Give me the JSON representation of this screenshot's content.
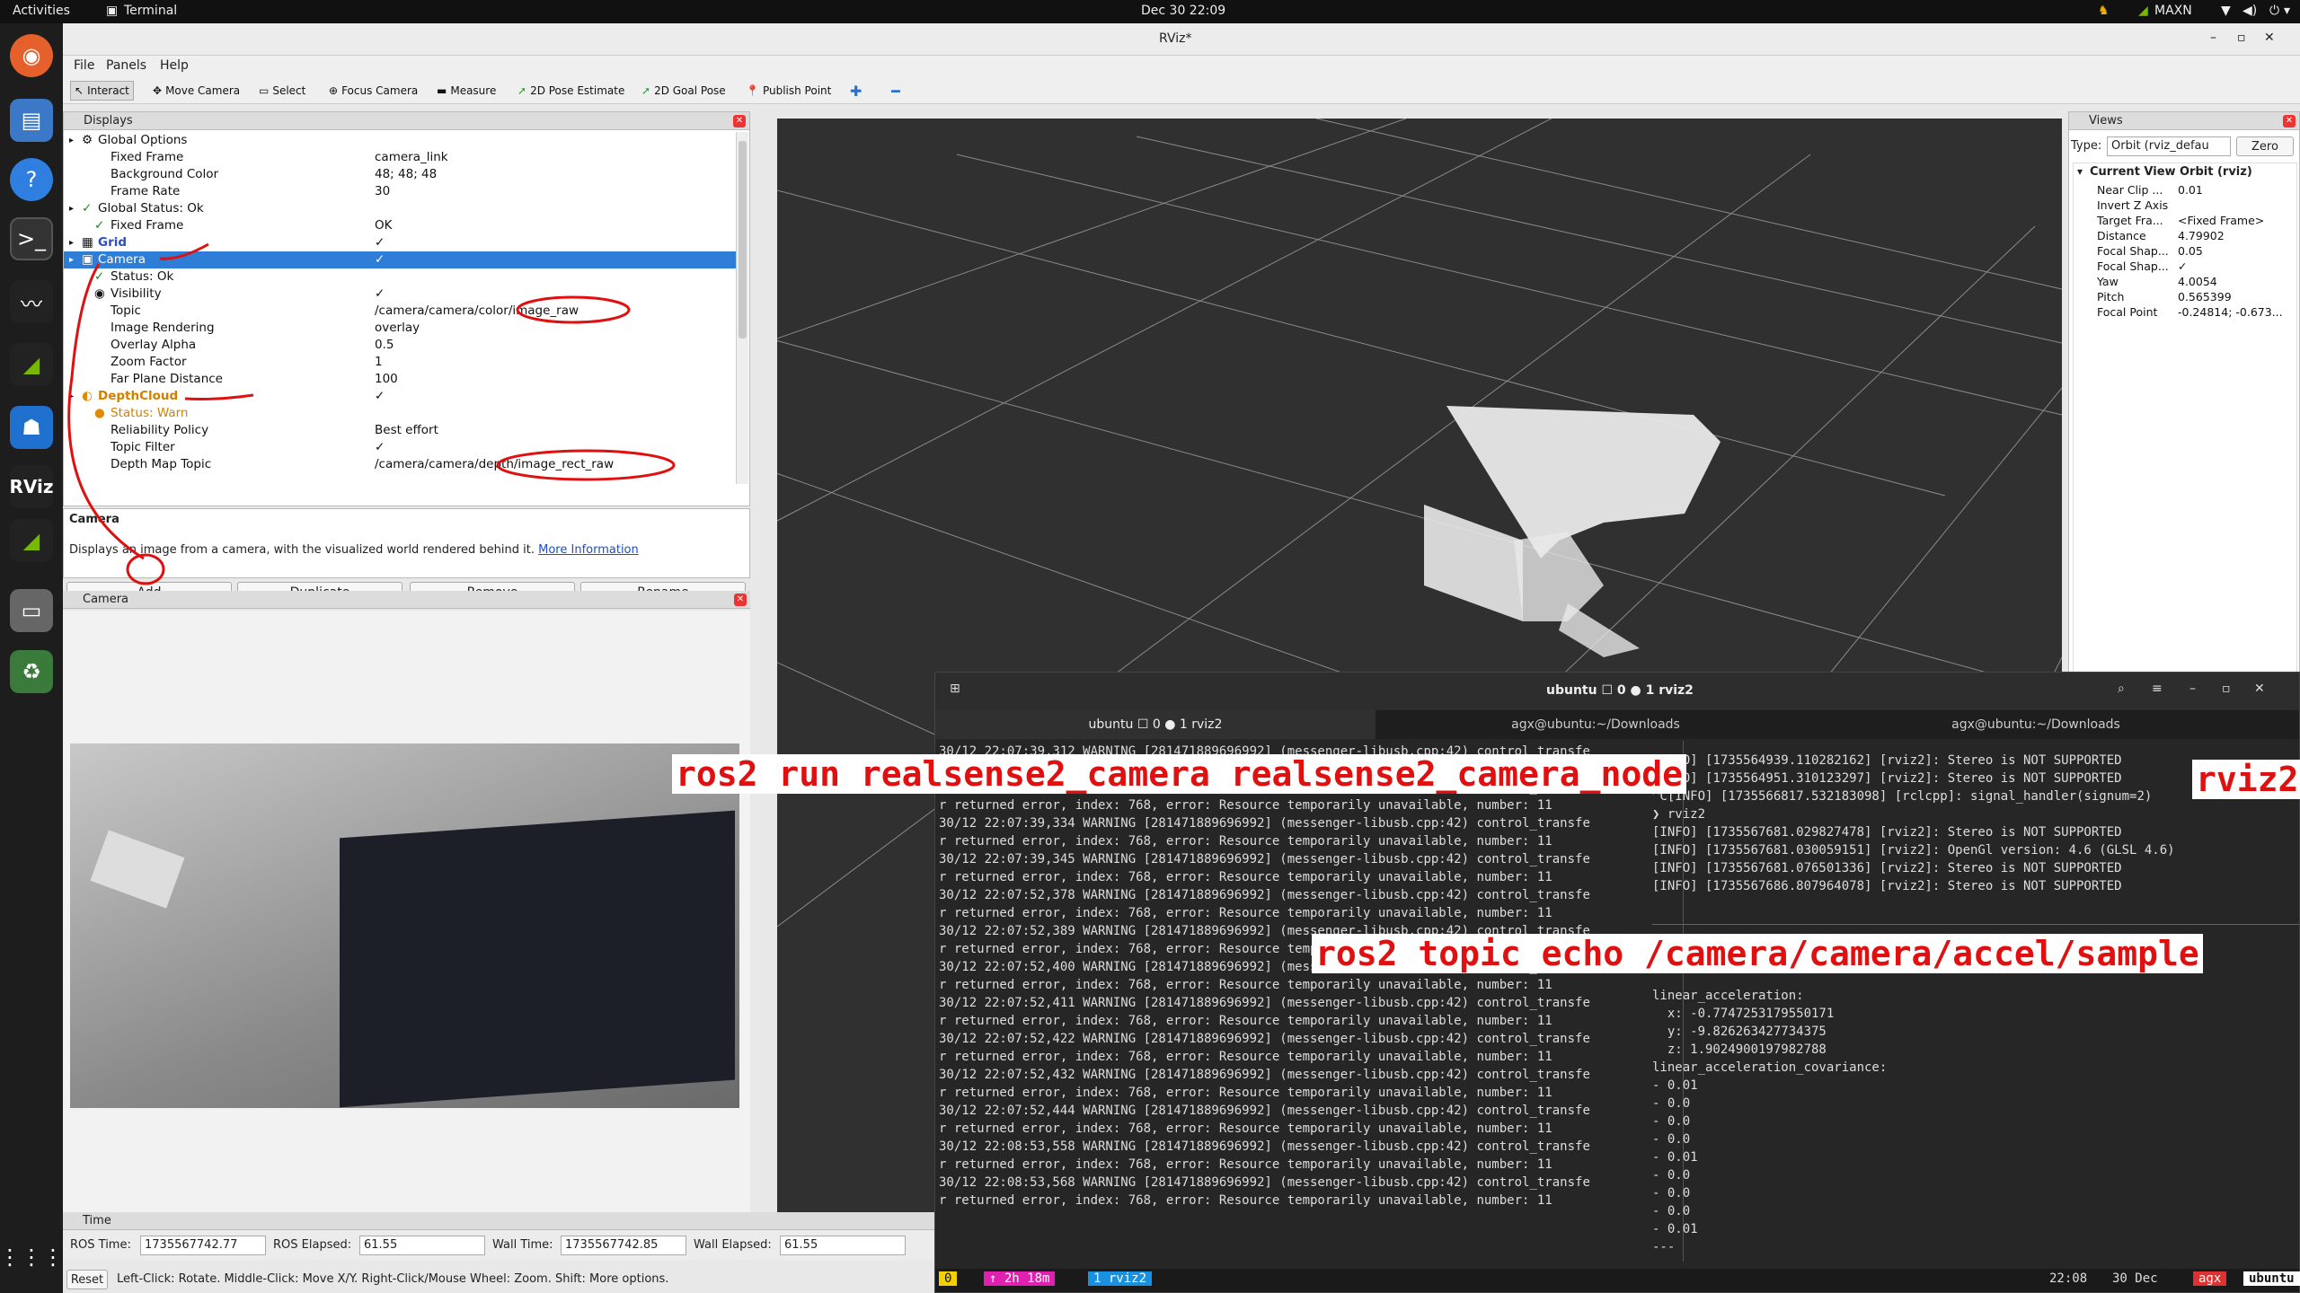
{
  "topbar": {
    "activities": "Activities",
    "app": "Terminal",
    "datetime": "Dec 30  22:09",
    "power_mode": "MAXN"
  },
  "window": {
    "title": "RViz*"
  },
  "menu": [
    "File",
    "Panels",
    "Help"
  ],
  "toolbar": [
    "Interact",
    "Move Camera",
    "Select",
    "Focus Camera",
    "Measure",
    "2D Pose Estimate",
    "2D Goal Pose",
    "Publish Point"
  ],
  "displays": {
    "title": "Displays",
    "rows": [
      {
        "n": "Global Options",
        "v": "",
        "d": 0
      },
      {
        "n": "Fixed Frame",
        "v": "camera_link",
        "d": 1
      },
      {
        "n": "Background Color",
        "v": "48; 48; 48",
        "d": 1
      },
      {
        "n": "Frame Rate",
        "v": "30",
        "d": 1
      },
      {
        "n": "Global Status: Ok",
        "v": "",
        "d": 0
      },
      {
        "n": "Fixed Frame",
        "v": "OK",
        "d": 1
      },
      {
        "n": "Grid",
        "v": "✓",
        "d": 0
      },
      {
        "n": "Camera",
        "v": "✓",
        "d": 0
      },
      {
        "n": "Status: Ok",
        "v": "",
        "d": 1
      },
      {
        "n": "Visibility",
        "v": "✓",
        "d": 1
      },
      {
        "n": "Topic",
        "v": "/camera/camera/color/image_raw",
        "d": 1
      },
      {
        "n": "Image Rendering",
        "v": "overlay",
        "d": 1
      },
      {
        "n": "Overlay Alpha",
        "v": "0.5",
        "d": 1
      },
      {
        "n": "Zoom Factor",
        "v": "1",
        "d": 1
      },
      {
        "n": "Far Plane Distance",
        "v": "100",
        "d": 1
      },
      {
        "n": "DepthCloud",
        "v": "✓",
        "d": 0
      },
      {
        "n": "Status: Warn",
        "v": "",
        "d": 1
      },
      {
        "n": "Reliability Policy",
        "v": "Best effort",
        "d": 1
      },
      {
        "n": "Topic Filter",
        "v": "✓",
        "d": 1
      },
      {
        "n": "Depth Map Topic",
        "v": "/camera/camera/depth/image_rect_raw",
        "d": 1
      }
    ],
    "desc_title": "Camera",
    "desc_text": "Displays an image from a camera, with the visualized world rendered behind it.",
    "desc_link": "More Information",
    "buttons": [
      "Add",
      "Duplicate",
      "Remove",
      "Rename"
    ]
  },
  "camera_panel": {
    "title": "Camera"
  },
  "views": {
    "title": "Views",
    "type_label": "Type:",
    "type_value": "Orbit (rviz_defau",
    "zero": "Zero",
    "current_view": "Current View",
    "current_value": "Orbit (rviz)",
    "rows": [
      {
        "n": "Near Clip ...",
        "v": "0.01"
      },
      {
        "n": "Invert Z Axis",
        "v": ""
      },
      {
        "n": "Target Fra...",
        "v": "<Fixed Frame>"
      },
      {
        "n": "Distance",
        "v": "4.79902"
      },
      {
        "n": "Focal Shap...",
        "v": "0.05"
      },
      {
        "n": "Focal Shap...",
        "v": "✓"
      },
      {
        "n": "Yaw",
        "v": "4.0054"
      },
      {
        "n": "Pitch",
        "v": "0.565399"
      },
      {
        "n": "Focal Point",
        "v": "-0.24814; -0.673..."
      }
    ]
  },
  "time": {
    "title": "Time",
    "ros_time_label": "ROS Time:",
    "ros_time": "1735567742.77",
    "ros_elapsed_label": "ROS Elapsed:",
    "ros_elapsed": "61.55",
    "wall_time_label": "Wall Time:",
    "wall_time": "1735567742.85",
    "wall_elapsed_label": "Wall Elapsed:",
    "wall_elapsed": "61.55"
  },
  "status": {
    "reset": "Reset",
    "hint": "Left-Click: Rotate. Middle-Click: Move X/Y. Right-Click/Mouse Wheel: Zoom. Shift: More options."
  },
  "terminal": {
    "title": "ubuntu ☐ 0 ● 1 rviz2",
    "tabs": [
      "ubuntu ☐ 0 ● 1 rviz2",
      "agx@ubuntu:~/Downloads",
      "agx@ubuntu:~/Downloads"
    ],
    "left_lines": [
      "30/12 22:07:39,312 WARNING [281471889696992] (messenger-libusb.cpp:42) control_transfe",
      "r returned error, index: 768, error: Resource temporarily unavailable, number: 11",
      "30/12 22:07:39,323 WARNING [281471889696992] (messenger-libusb.cpp:42) control_transfe",
      "r returned error, index: 768, error: Resource temporarily unavailable, number: 11",
      "30/12 22:07:39,334 WARNING [281471889696992] (messenger-libusb.cpp:42) control_transfe",
      "r returned error, index: 768, error: Resource temporarily unavailable, number: 11",
      "30/12 22:07:39,345 WARNING [281471889696992] (messenger-libusb.cpp:42) control_transfe",
      "r returned error, index: 768, error: Resource temporarily unavailable, number: 11",
      "30/12 22:07:52,378 WARNING [281471889696992] (messenger-libusb.cpp:42) control_transfe",
      "r returned error, index: 768, error: Resource temporarily unavailable, number: 11",
      "30/12 22:07:52,389 WARNING [281471889696992] (messenger-libusb.cpp:42) control_transfe",
      "r returned error, index: 768, error: Resource temporarily unavailable, number: 11",
      "30/12 22:07:52,400 WARNING [281471889696992] (messenger-libusb.cpp:42) control_transfe",
      "r returned error, index: 768, error: Resource temporarily unavailable, number: 11",
      "30/12 22:07:52,411 WARNING [281471889696992] (messenger-libusb.cpp:42) control_transfe",
      "r returned error, index: 768, error: Resource temporarily unavailable, number: 11",
      "30/12 22:07:52,422 WARNING [281471889696992] (messenger-libusb.cpp:42) control_transfe",
      "r returned error, index: 768, error: Resource temporarily unavailable, number: 11",
      "30/12 22:07:52,432 WARNING [281471889696992] (messenger-libusb.cpp:42) control_transfe",
      "r returned error, index: 768, error: Resource temporarily unavailable, number: 11",
      "30/12 22:07:52,444 WARNING [281471889696992] (messenger-libusb.cpp:42) control_transfe",
      "r returned error, index: 768, error: Resource temporarily unavailable, number: 11",
      "30/12 22:08:53,558 WARNING [281471889696992] (messenger-libusb.cpp:42) control_transfe",
      "r returned error, index: 768, error: Resource temporarily unavailable, number: 11",
      "30/12 22:08:53,568 WARNING [281471889696992] (messenger-libusb.cpp:42) control_transfe",
      "r returned error, index: 768, error: Resource temporarily unavailable, number: 11"
    ],
    "right_top_lines": [
      "[INFO] [1735564939.110282162] [rviz2]: Stereo is NOT SUPPORTED",
      "[INFO] [1735564951.310123297] [rviz2]: Stereo is NOT SUPPORTED",
      "^C[INFO] [1735566817.532183098] [rclcpp]: signal_handler(signum=2)",
      "❯ rviz2",
      "[INFO] [1735567681.029827478] [rviz2]: Stereo is NOT SUPPORTED",
      "[INFO] [1735567681.030059151] [rviz2]: OpenGl version: 4.6 (GLSL 4.6)",
      "[INFO] [1735567681.076501336] [rviz2]: Stereo is NOT SUPPORTED",
      "[INFO] [1735567686.807964078] [rviz2]: Stereo is NOT SUPPORTED"
    ],
    "right_bottom_lines": [
      "linear_acceleration:",
      "  x: -0.7747253179550171",
      "  y: -9.826263427734375",
      "  z: 1.9024900197982788",
      "linear_acceleration_covariance:",
      "- 0.01",
      "- 0.0",
      "- 0.0",
      "- 0.0",
      "- 0.01",
      "- 0.0",
      "- 0.0",
      "- 0.0",
      "- 0.01",
      "---"
    ],
    "statusbar": {
      "s0": "0",
      "s1": "↑ 2h 18m",
      "s2": "1 rviz2",
      "time": "22:08",
      "date": "30 Dec",
      "host": "agx",
      "user": "ubuntu"
    }
  },
  "annotations": {
    "a1": "ros2 run realsense2_camera realsense2_camera_node",
    "a2": "rviz2",
    "a3": "ros2 topic echo /camera/camera/accel/sample"
  }
}
